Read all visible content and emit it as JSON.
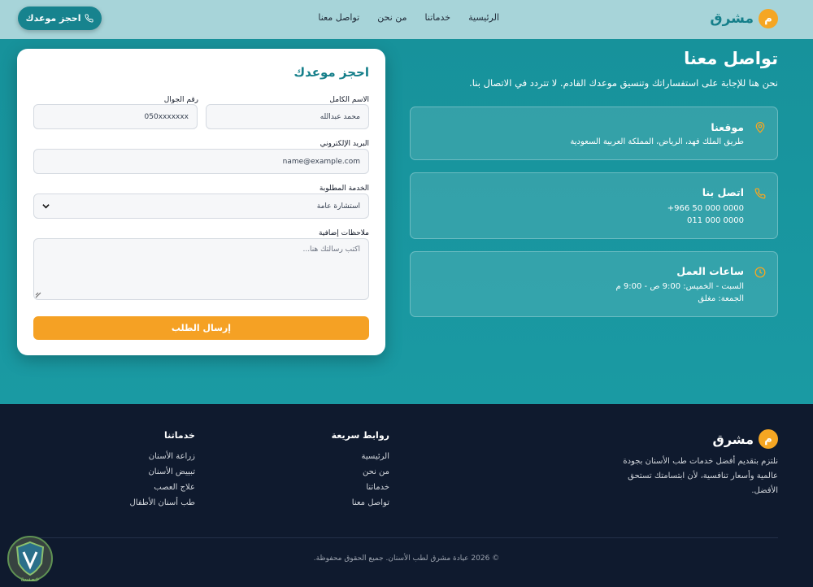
{
  "header": {
    "brand_letter": "م",
    "brand_name": "مشرق",
    "nav": [
      "الرئيسية",
      "خدماتنا",
      "من نحن",
      "تواصل معنا"
    ],
    "cta_label": "احجز موعدك"
  },
  "contact": {
    "title": "تواصل معنا",
    "subtitle": "نحن هنا للإجابة على استفساراتك وتنسيق موعدك القادم. لا تتردد في الاتصال بنا.",
    "location": {
      "title": "موقعنا",
      "line1": "طريق الملك فهد، الرياض، المملكة العربية السعودية"
    },
    "phone": {
      "title": "اتصل بنا",
      "line1": "+966 50 000 0000",
      "line2": "011 000 0000"
    },
    "hours": {
      "title": "ساعات العمل",
      "line1": "السبت - الخميس: 9:00 ص - 9:00 م",
      "line2": "الجمعة: مغلق"
    }
  },
  "form": {
    "title": "احجز موعدك",
    "name_label": "الاسم الكامل",
    "name_value": "محمد عبدالله",
    "phone_label": "رقم الجوال",
    "phone_value": "050xxxxxxx",
    "email_label": "البريد الإلكتروني",
    "email_value": "name@example.com",
    "service_label": "الخدمة المطلوبة",
    "service_value": "استشارة عامة",
    "notes_label": "ملاحظات إضافية",
    "notes_placeholder": "اكتب رسالتك هنا...",
    "submit_label": "إرسال الطلب"
  },
  "footer": {
    "brand_letter": "م",
    "brand_name": "مشرق",
    "about": "نلتزم بتقديم أفضل خدمات طب الأسنان بجودة عالمية وأسعار تنافسية، لأن ابتسامتك تستحق الأفضل.",
    "quick_links": {
      "title": "روابط سريعة",
      "items": [
        "الرئيسية",
        "من نحن",
        "خدماتنا",
        "تواصل معنا"
      ]
    },
    "services": {
      "title": "خدماتنا",
      "items": [
        "زراعة الأسنان",
        "تبييض الأسنان",
        "علاج العصب",
        "طب أسنان الأطفال"
      ]
    },
    "copyright": "© 2026 عيادة مشرق لطب الأسنان. جميع الحقوق محفوظة."
  },
  "watermark_text": "خمسة",
  "colors": {
    "teal": "#17929b",
    "brand_teal": "#157f8a",
    "orange": "#f5a124",
    "navy": "#0f1a2e",
    "header_bg": "#a7d4d9"
  }
}
